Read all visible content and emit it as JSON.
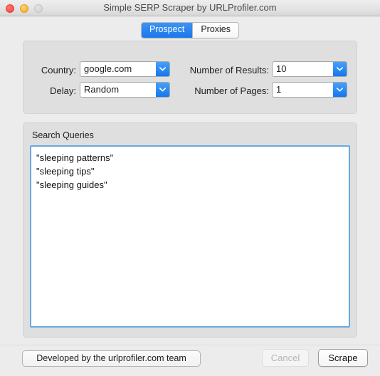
{
  "window": {
    "title": "Simple SERP Scraper by URLProfiler.com",
    "controls": {
      "close": "close-button",
      "minimize": "minimize-button",
      "zoom": "zoom-button"
    }
  },
  "tabs": [
    {
      "label": "Prospect",
      "active": true
    },
    {
      "label": "Proxies",
      "active": false
    }
  ],
  "settings": {
    "country": {
      "label": "Country:",
      "value": "google.com"
    },
    "delay": {
      "label": "Delay:",
      "value": "Random"
    },
    "number_of_results": {
      "label": "Number of Results:",
      "value": "10"
    },
    "number_of_pages": {
      "label": "Number of Pages:",
      "value": "1"
    }
  },
  "queries": {
    "title": "Search Queries",
    "value": "\"sleeping patterns\"\n\"sleeping tips\"\n\"sleeping guides\"",
    "placeholder": ""
  },
  "footer": {
    "credit_label": "Developed by the urlprofiler.com team",
    "cancel_label": "Cancel",
    "scrape_label": "Scrape"
  },
  "colors": {
    "accent_blue": "#1d76ec",
    "dropdown_arrow_blue": "#1577ef",
    "focus_border": "#6aa9e0",
    "window_bg": "#ececec",
    "group_bg": "#dfdfdf"
  }
}
